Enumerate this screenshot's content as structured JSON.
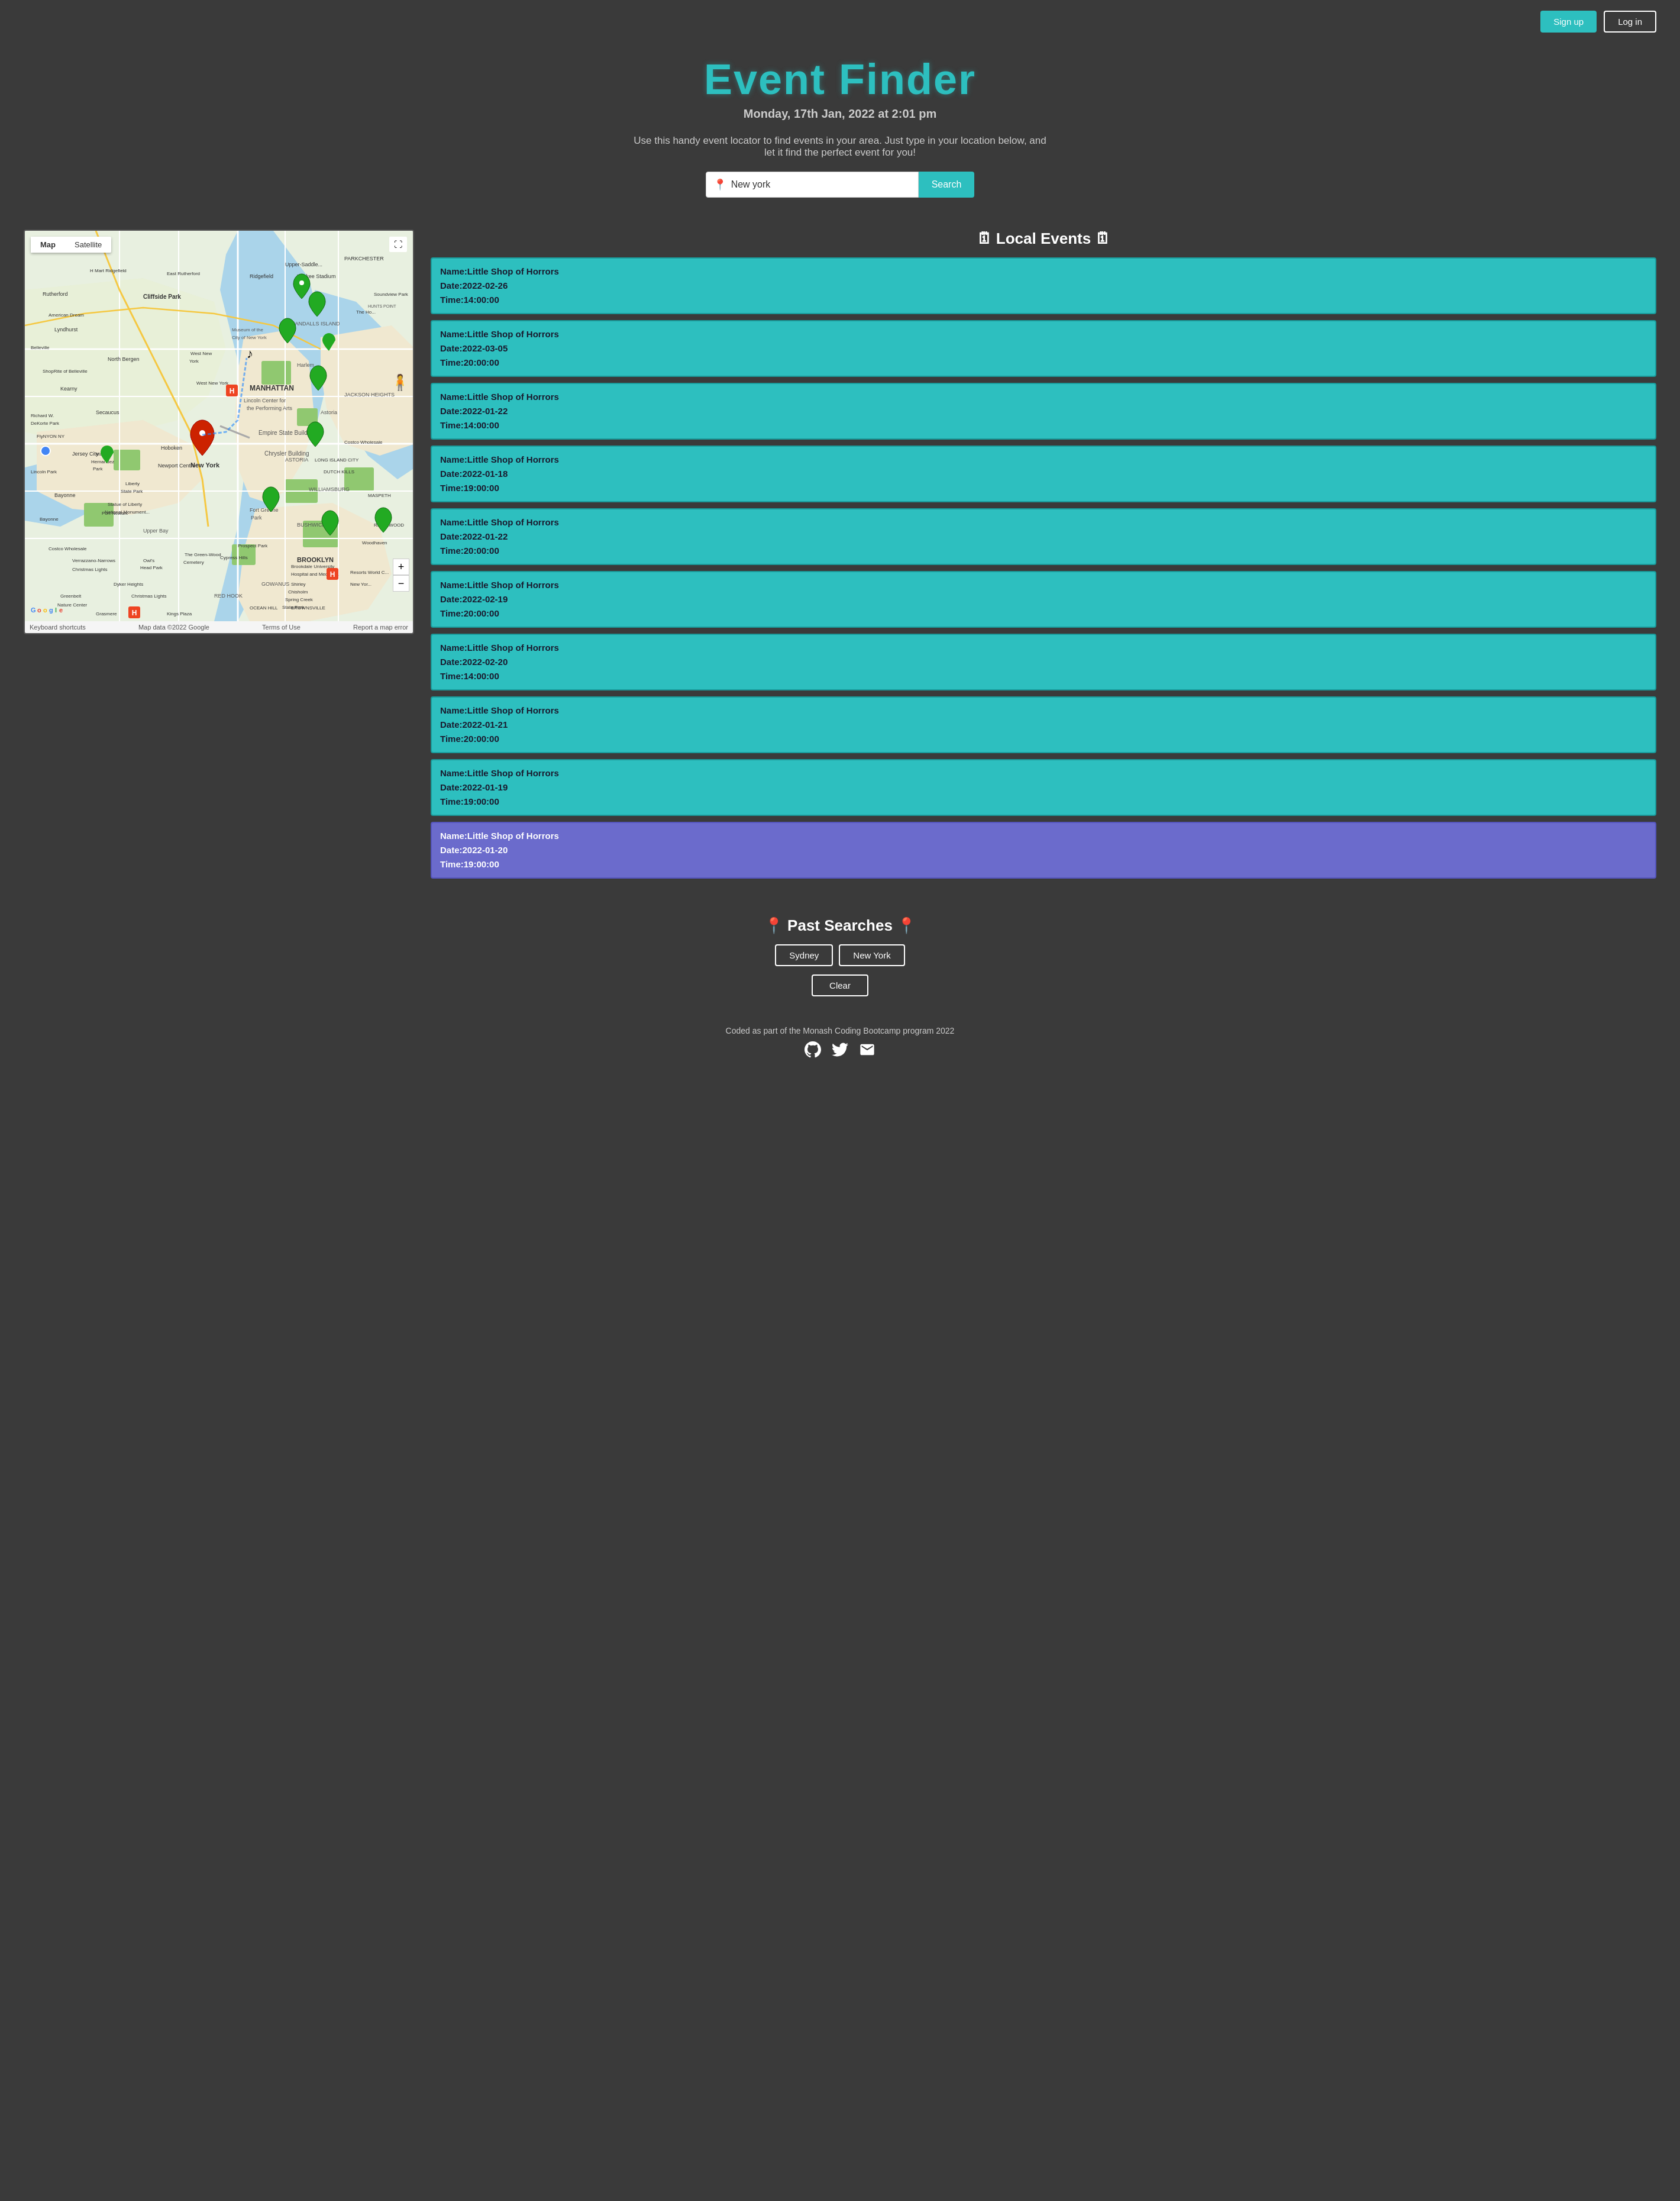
{
  "navbar": {
    "signup_label": "Sign up",
    "login_label": "Log in"
  },
  "hero": {
    "title": "Event Finder",
    "date": "Monday, 17th Jan, 2022 at 2:01 pm",
    "description": "Use this handy event locator to find events in your area. Just type in your location below, and let it find the perfect event for you!"
  },
  "search": {
    "placeholder": "New york",
    "value": "New york",
    "button_label": "Search"
  },
  "map": {
    "tab_map": "Map",
    "tab_satellite": "Satellite",
    "footer_keyboard": "Keyboard shortcuts",
    "footer_data": "Map data ©2022 Google",
    "footer_terms": "Terms of Use",
    "footer_report": "Report a map error"
  },
  "events": {
    "title": "Local Events",
    "items": [
      {
        "name": "Little Shop of Horrors",
        "date": "2022-02-26",
        "time": "14:00:00",
        "highlighted": false
      },
      {
        "name": "Little Shop of Horrors",
        "date": "2022-03-05",
        "time": "20:00:00",
        "highlighted": false
      },
      {
        "name": "Little Shop of Horrors",
        "date": "2022-01-22",
        "time": "14:00:00",
        "highlighted": false
      },
      {
        "name": "Little Shop of Horrors",
        "date": "2022-01-18",
        "time": "19:00:00",
        "highlighted": false
      },
      {
        "name": "Little Shop of Horrors",
        "date": "2022-01-22",
        "time": "20:00:00",
        "highlighted": false
      },
      {
        "name": "Little Shop of Horrors",
        "date": "2022-02-19",
        "time": "20:00:00",
        "highlighted": false
      },
      {
        "name": "Little Shop of Horrors",
        "date": "2022-02-20",
        "time": "14:00:00",
        "highlighted": false
      },
      {
        "name": "Little Shop of Horrors",
        "date": "2022-01-21",
        "time": "20:00:00",
        "highlighted": false
      },
      {
        "name": "Little Shop of Horrors",
        "date": "2022-01-19",
        "time": "19:00:00",
        "highlighted": false
      },
      {
        "name": "Little Shop of Horrors",
        "date": "2022-01-20",
        "time": "19:00:00",
        "highlighted": true
      }
    ]
  },
  "past_searches": {
    "title": "Past Searches",
    "items": [
      "Sydney",
      "New York"
    ],
    "clear_label": "Clear"
  },
  "footer": {
    "text": "Coded as part of the Monash Coding Bootcamp program 2022",
    "icons": [
      "github-icon",
      "twitter-icon",
      "email-icon"
    ]
  }
}
